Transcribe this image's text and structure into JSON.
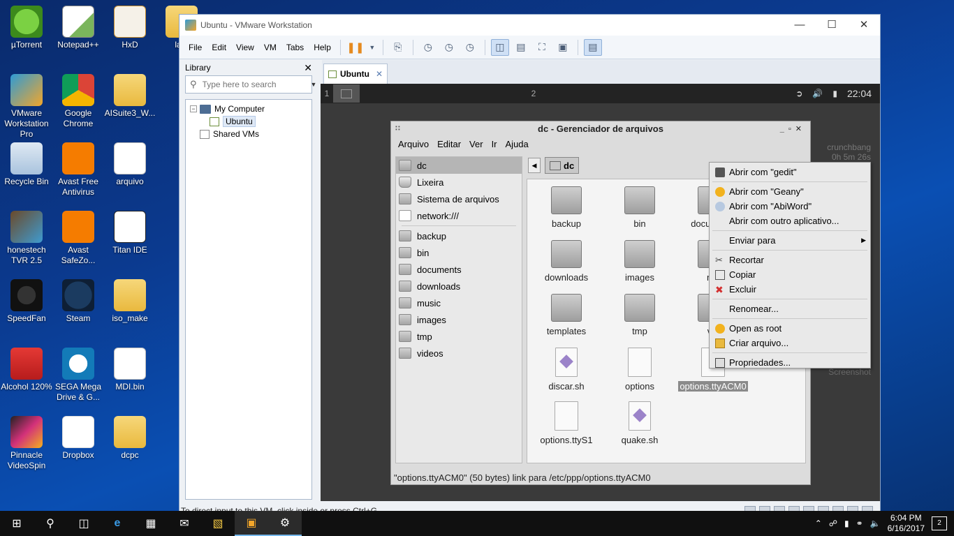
{
  "desktop": {
    "icons": [
      {
        "label": "µTorrent",
        "icon": "utorrent-icon"
      },
      {
        "label": "Notepad++",
        "icon": "notepad-icon"
      },
      {
        "label": "HxD",
        "icon": "hxd-icon"
      },
      {
        "label": "lant",
        "icon": "folder-icon"
      },
      {
        "label": "VMware Workstation Pro",
        "icon": "vmware-icon"
      },
      {
        "label": "Google Chrome",
        "icon": "chrome-icon"
      },
      {
        "label": "AISuite3_W...",
        "icon": "folder-icon"
      },
      {
        "label": "Recycle Bin",
        "icon": "recycle-bin-icon"
      },
      {
        "label": "Avast Free Antivirus",
        "icon": "avast-icon"
      },
      {
        "label": "arquivo",
        "icon": "document-icon"
      },
      {
        "label": "honestech TVR 2.5",
        "icon": "honestech-icon"
      },
      {
        "label": "Avast SafeZo...",
        "icon": "avast-safezone-icon"
      },
      {
        "label": "Titan IDE",
        "icon": "titan-icon"
      },
      {
        "label": "SpeedFan",
        "icon": "speedfan-icon"
      },
      {
        "label": "Steam",
        "icon": "steam-icon"
      },
      {
        "label": "iso_make",
        "icon": "folder-icon"
      },
      {
        "label": "Alcohol 120%",
        "icon": "alcohol-icon"
      },
      {
        "label": "SEGA Mega Drive & G...",
        "icon": "sega-icon"
      },
      {
        "label": "MDI.bin",
        "icon": "file-icon"
      },
      {
        "label": "Pinnacle VideoSpin",
        "icon": "pinnacle-icon"
      },
      {
        "label": "Dropbox",
        "icon": "dropbox-icon"
      },
      {
        "label": "dcpc",
        "icon": "folder-icon"
      }
    ]
  },
  "vmware": {
    "title": "Ubuntu - VMware Workstation",
    "menu": [
      "File",
      "Edit",
      "View",
      "VM",
      "Tabs",
      "Help"
    ],
    "library": {
      "title": "Library",
      "search_placeholder": "Type here to search",
      "tree": {
        "root": "My Computer",
        "child": "Ubuntu",
        "shared": "Shared VMs"
      }
    },
    "tab_label": "Ubuntu",
    "status": "To direct input to this VM, click inside or press Ctrl+G."
  },
  "guest": {
    "workspaces": [
      "1",
      "2"
    ],
    "clock": "22:04",
    "conky": [
      "crunchbang",
      "0h 5m 26s"
    ],
    "conky_shortcut": "Screenshot",
    "file_manager": {
      "title": "dc - Gerenciador de arquivos",
      "menu": [
        "Arquivo",
        "Editar",
        "Ver",
        "Ir",
        "Ajuda"
      ],
      "sidebar_top": [
        "dc",
        "Lixeira",
        "Sistema de arquivos",
        "network:///"
      ],
      "sidebar_bookmarks": [
        "backup",
        "bin",
        "documents",
        "downloads",
        "music",
        "images",
        "tmp",
        "videos"
      ],
      "path": "dc",
      "files": [
        {
          "name": "backup",
          "kind": "folder"
        },
        {
          "name": "bin",
          "kind": "folder"
        },
        {
          "name": "documents",
          "kind": "folder"
        },
        {
          "name": "downloads",
          "kind": "folder"
        },
        {
          "name": "images",
          "kind": "folder"
        },
        {
          "name": "mu",
          "kind": "folder"
        },
        {
          "name": "templates",
          "kind": "folder"
        },
        {
          "name": "tmp",
          "kind": "folder"
        },
        {
          "name": "vid",
          "kind": "folder"
        },
        {
          "name": "discar.sh",
          "kind": "script"
        },
        {
          "name": "options",
          "kind": "link"
        },
        {
          "name": "options.ttyACM0",
          "kind": "link",
          "selected": true
        },
        {
          "name": "options.ttyS1",
          "kind": "link"
        },
        {
          "name": "quake.sh",
          "kind": "script"
        }
      ],
      "status": "\"options.ttyACM0\" (50 bytes) link para /etc/ppp/options.ttyACM0"
    },
    "context_menu": {
      "open_gedit": "Abrir com \"gedit\"",
      "open_geany": "Abrir com \"Geany\"",
      "open_abiword": "Abrir com \"AbiWord\"",
      "open_other": "Abrir com outro aplicativo...",
      "send_to": "Enviar para",
      "cut": "Recortar",
      "copy": "Copiar",
      "delete": "Excluir",
      "rename": "Renomear...",
      "open_root": "Open as root",
      "create_file": "Criar arquivo...",
      "properties": "Propriedades..."
    }
  },
  "taskbar": {
    "time": "6:04 PM",
    "date": "6/16/2017",
    "notifications": "2"
  }
}
